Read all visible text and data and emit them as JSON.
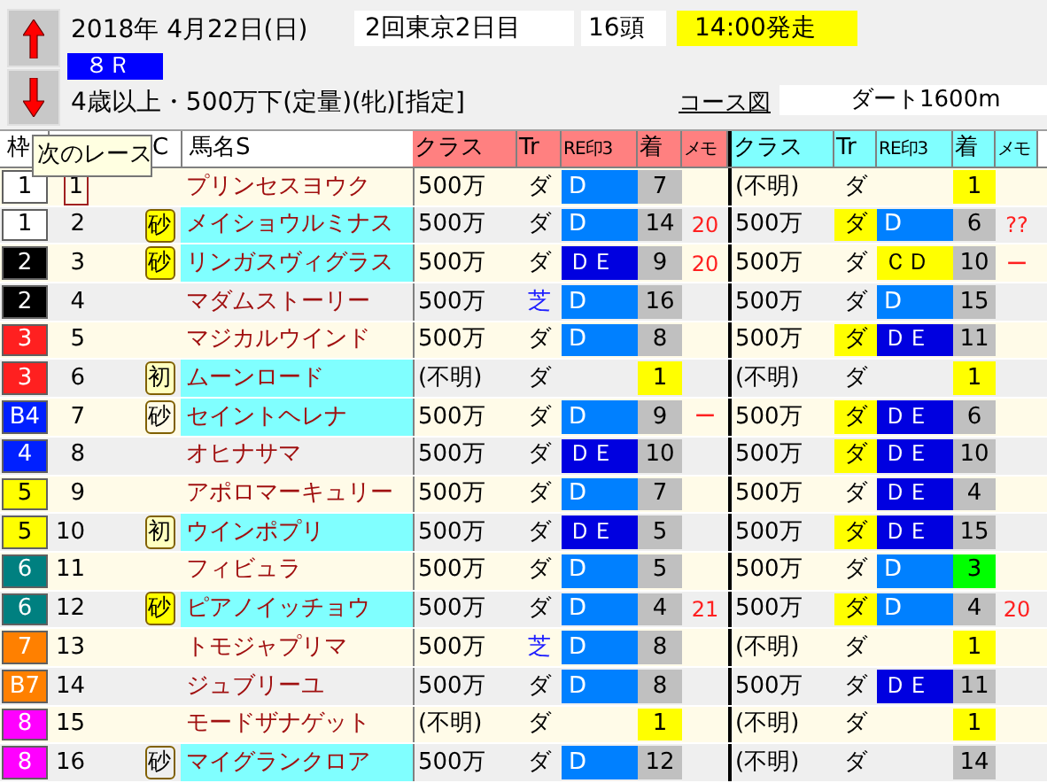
{
  "race_info": {
    "date": "2018年 4月22日(日)",
    "meeting": "2回東京2日目",
    "runners": "16頭",
    "start_time": "14:00発走",
    "race_number": "８Ｒ",
    "conditions": "4歳以上・500万下(定量)(牝)[指定]",
    "course_link": "コース図",
    "course": "ダート1600m"
  },
  "tooltip": "次のレース",
  "headers": {
    "left": [
      "枠",
      "C",
      "馬名S"
    ],
    "race_1": [
      "クラス",
      "Tr",
      "RE印3",
      "着",
      "メモ"
    ],
    "race_2": [
      "クラス",
      "Tr",
      "RE印3",
      "着",
      "メモ"
    ]
  },
  "rows": [
    {
      "waku": {
        "text": "1",
        "color": "#ffffff"
      },
      "number": "1",
      "selected": true,
      "name": "プリンセスヨウク",
      "name_highlight": false,
      "races": [
        {
          "class": "500万",
          "track": "ダ",
          "turf": false,
          "track_highlight": false,
          "re": {
            "text": "D",
            "color": "#0080ff"
          },
          "finish": {
            "text": "7",
            "color": "#c0c0c0"
          }
        },
        {
          "class": "(不明)",
          "track": "ダ",
          "turf": false,
          "track_highlight": false,
          "finish": {
            "text": "1",
            "color": "#ffff00"
          }
        }
      ]
    },
    {
      "waku": {
        "text": "1",
        "color": "#ffffff"
      },
      "number": "2",
      "selected": false,
      "mark": {
        "text": "砂",
        "kind": "strong"
      },
      "name": "メイショウルミナス",
      "name_highlight": true,
      "races": [
        {
          "class": "500万",
          "track": "ダ",
          "turf": false,
          "track_highlight": false,
          "re": {
            "text": "D",
            "color": "#0080ff"
          },
          "finish": {
            "text": "14",
            "color": "#c0c0c0"
          },
          "memo": "20"
        },
        {
          "class": "500万",
          "track": "ダ",
          "turf": false,
          "track_highlight": true,
          "re": {
            "text": "D",
            "color": "#0080ff"
          },
          "finish": {
            "text": "6",
            "color": "#c0c0c0"
          },
          "memo": "??"
        }
      ]
    },
    {
      "waku": {
        "text": "2",
        "color": "#000000"
      },
      "number": "3",
      "selected": false,
      "mark": {
        "text": "砂",
        "kind": "strong"
      },
      "name": "リンガスヴィグラス",
      "name_highlight": true,
      "races": [
        {
          "class": "500万",
          "track": "ダ",
          "turf": false,
          "track_highlight": false,
          "re": {
            "text": "ＤＥ",
            "color": "#0000e0"
          },
          "finish": {
            "text": "9",
            "color": "#c0c0c0"
          },
          "memo": "20"
        },
        {
          "class": "500万",
          "track": "ダ",
          "turf": false,
          "track_highlight": false,
          "re": {
            "text": "ＣＤ",
            "color": "#ffff00"
          },
          "finish": {
            "text": "10",
            "color": "#c0c0c0"
          },
          "memo": "ー"
        }
      ]
    },
    {
      "waku": {
        "text": "2",
        "color": "#000000"
      },
      "number": "4",
      "selected": false,
      "name": "マダムストーリー",
      "name_highlight": false,
      "races": [
        {
          "class": "500万",
          "track": "芝",
          "turf": true,
          "track_highlight": false,
          "re": {
            "text": "D",
            "color": "#0080ff"
          },
          "finish": {
            "text": "16",
            "color": "#c0c0c0"
          }
        },
        {
          "class": "500万",
          "track": "ダ",
          "turf": false,
          "track_highlight": false,
          "re": {
            "text": "D",
            "color": "#0080ff"
          },
          "finish": {
            "text": "15",
            "color": "#c0c0c0"
          }
        }
      ]
    },
    {
      "waku": {
        "text": "3",
        "color": "#ff2020"
      },
      "number": "5",
      "selected": false,
      "name": "マジカルウインド",
      "name_highlight": false,
      "races": [
        {
          "class": "500万",
          "track": "ダ",
          "turf": false,
          "track_highlight": false,
          "re": {
            "text": "D",
            "color": "#0080ff"
          },
          "finish": {
            "text": "8",
            "color": "#c0c0c0"
          }
        },
        {
          "class": "500万",
          "track": "ダ",
          "turf": false,
          "track_highlight": true,
          "re": {
            "text": "ＤＥ",
            "color": "#0000e0"
          },
          "finish": {
            "text": "11",
            "color": "#c0c0c0"
          }
        }
      ]
    },
    {
      "waku": {
        "text": "3",
        "color": "#ff2020"
      },
      "number": "6",
      "selected": false,
      "mark": {
        "text": "初",
        "kind": "pale"
      },
      "name": "ムーンロード",
      "name_highlight": true,
      "races": [
        {
          "class": "(不明)",
          "track": "ダ",
          "turf": false,
          "track_highlight": false,
          "finish": {
            "text": "1",
            "color": "#ffff00"
          }
        },
        {
          "class": "(不明)",
          "track": "ダ",
          "turf": false,
          "track_highlight": false,
          "finish": {
            "text": "1",
            "color": "#ffff00"
          }
        }
      ]
    },
    {
      "waku": {
        "text": "B4",
        "color": "#0020ff"
      },
      "number": "7",
      "selected": false,
      "mark": {
        "text": "砂",
        "kind": "plain"
      },
      "name": "セイントヘレナ",
      "name_highlight": true,
      "races": [
        {
          "class": "500万",
          "track": "ダ",
          "turf": false,
          "track_highlight": false,
          "re": {
            "text": "D",
            "color": "#0080ff"
          },
          "finish": {
            "text": "9",
            "color": "#c0c0c0"
          },
          "memo": "ー"
        },
        {
          "class": "500万",
          "track": "ダ",
          "turf": false,
          "track_highlight": true,
          "re": {
            "text": "ＤＥ",
            "color": "#0000e0"
          },
          "finish": {
            "text": "6",
            "color": "#c0c0c0"
          }
        }
      ]
    },
    {
      "waku": {
        "text": "4",
        "color": "#0020ff"
      },
      "number": "8",
      "selected": false,
      "name": "オヒナサマ",
      "name_highlight": false,
      "races": [
        {
          "class": "500万",
          "track": "ダ",
          "turf": false,
          "track_highlight": false,
          "re": {
            "text": "ＤＥ",
            "color": "#0000e0"
          },
          "finish": {
            "text": "10",
            "color": "#c0c0c0"
          }
        },
        {
          "class": "500万",
          "track": "ダ",
          "turf": false,
          "track_highlight": true,
          "re": {
            "text": "ＤＥ",
            "color": "#0000e0"
          },
          "finish": {
            "text": "10",
            "color": "#c0c0c0"
          }
        }
      ]
    },
    {
      "waku": {
        "text": "5",
        "color": "#ffff00"
      },
      "number": "9",
      "selected": false,
      "name": "アポロマーキュリー",
      "name_highlight": false,
      "races": [
        {
          "class": "500万",
          "track": "ダ",
          "turf": false,
          "track_highlight": false,
          "re": {
            "text": "D",
            "color": "#0080ff"
          },
          "finish": {
            "text": "7",
            "color": "#c0c0c0"
          }
        },
        {
          "class": "500万",
          "track": "ダ",
          "turf": false,
          "track_highlight": false,
          "re": {
            "text": "ＤＥ",
            "color": "#0000e0"
          },
          "finish": {
            "text": "4",
            "color": "#c0c0c0"
          }
        }
      ]
    },
    {
      "waku": {
        "text": "5",
        "color": "#ffff00"
      },
      "number": "10",
      "selected": false,
      "mark": {
        "text": "初",
        "kind": "pale"
      },
      "name": "ウインポプリ",
      "name_highlight": true,
      "races": [
        {
          "class": "500万",
          "track": "ダ",
          "turf": false,
          "track_highlight": false,
          "re": {
            "text": "ＤＥ",
            "color": "#0000e0"
          },
          "finish": {
            "text": "5",
            "color": "#c0c0c0"
          }
        },
        {
          "class": "500万",
          "track": "ダ",
          "turf": false,
          "track_highlight": true,
          "re": {
            "text": "ＤＥ",
            "color": "#0000e0"
          },
          "finish": {
            "text": "15",
            "color": "#c0c0c0"
          }
        }
      ]
    },
    {
      "waku": {
        "text": "6",
        "color": "#008080"
      },
      "number": "11",
      "selected": false,
      "name": "フィビュラ",
      "name_highlight": false,
      "races": [
        {
          "class": "500万",
          "track": "ダ",
          "turf": false,
          "track_highlight": false,
          "re": {
            "text": "D",
            "color": "#0080ff"
          },
          "finish": {
            "text": "5",
            "color": "#c0c0c0"
          }
        },
        {
          "class": "500万",
          "track": "ダ",
          "turf": false,
          "track_highlight": false,
          "re": {
            "text": "D",
            "color": "#0080ff"
          },
          "finish": {
            "text": "3",
            "color": "#00ff00"
          }
        }
      ]
    },
    {
      "waku": {
        "text": "6",
        "color": "#008080"
      },
      "number": "12",
      "selected": false,
      "mark": {
        "text": "砂",
        "kind": "strong"
      },
      "name": "ピアノイッチョウ",
      "name_highlight": true,
      "races": [
        {
          "class": "500万",
          "track": "ダ",
          "turf": false,
          "track_highlight": false,
          "re": {
            "text": "D",
            "color": "#0080ff"
          },
          "finish": {
            "text": "4",
            "color": "#c0c0c0"
          },
          "memo": "21"
        },
        {
          "class": "500万",
          "track": "ダ",
          "turf": false,
          "track_highlight": true,
          "re": {
            "text": "D",
            "color": "#0080ff"
          },
          "finish": {
            "text": "4",
            "color": "#c0c0c0"
          },
          "memo": "20"
        }
      ]
    },
    {
      "waku": {
        "text": "7",
        "color": "#ff8000"
      },
      "number": "13",
      "selected": false,
      "name": "トモジャプリマ",
      "name_highlight": false,
      "races": [
        {
          "class": "500万",
          "track": "芝",
          "turf": true,
          "track_highlight": false,
          "re": {
            "text": "D",
            "color": "#0080ff"
          },
          "finish": {
            "text": "8",
            "color": "#c0c0c0"
          }
        },
        {
          "class": "(不明)",
          "track": "ダ",
          "turf": false,
          "track_highlight": false,
          "finish": {
            "text": "1",
            "color": "#ffff00"
          }
        }
      ]
    },
    {
      "waku": {
        "text": "B7",
        "color": "#ff8000"
      },
      "number": "14",
      "selected": false,
      "name": "ジュブリーユ",
      "name_highlight": false,
      "races": [
        {
          "class": "500万",
          "track": "ダ",
          "turf": false,
          "track_highlight": false,
          "re": {
            "text": "D",
            "color": "#0080ff"
          },
          "finish": {
            "text": "8",
            "color": "#c0c0c0"
          }
        },
        {
          "class": "500万",
          "track": "ダ",
          "turf": false,
          "track_highlight": false,
          "re": {
            "text": "ＤＥ",
            "color": "#0000e0"
          },
          "finish": {
            "text": "11",
            "color": "#c0c0c0"
          }
        }
      ]
    },
    {
      "waku": {
        "text": "8",
        "color": "#ff00ff"
      },
      "number": "15",
      "selected": false,
      "name": "モードザナゲット",
      "name_highlight": false,
      "races": [
        {
          "class": "(不明)",
          "track": "ダ",
          "turf": false,
          "track_highlight": false,
          "finish": {
            "text": "1",
            "color": "#ffff00"
          }
        },
        {
          "class": "(不明)",
          "track": "ダ",
          "turf": false,
          "track_highlight": false,
          "finish": {
            "text": "1",
            "color": "#ffff00"
          }
        }
      ]
    },
    {
      "waku": {
        "text": "8",
        "color": "#ff00ff"
      },
      "number": "16",
      "selected": false,
      "mark": {
        "text": "砂",
        "kind": "plain"
      },
      "name": "マイグランクロア",
      "name_highlight": true,
      "races": [
        {
          "class": "500万",
          "track": "ダ",
          "turf": false,
          "track_highlight": false,
          "re": {
            "text": "D",
            "color": "#0080ff"
          },
          "finish": {
            "text": "12",
            "color": "#c0c0c0"
          }
        },
        {
          "class": "(不明)",
          "track": "ダ",
          "turf": false,
          "track_highlight": false,
          "finish": {
            "text": "14",
            "color": "#c0c0c0"
          }
        }
      ]
    }
  ]
}
